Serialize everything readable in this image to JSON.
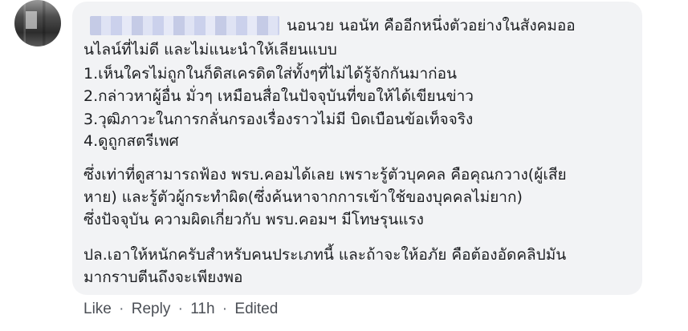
{
  "comment": {
    "first_line_text": "นอนวย นอนัท คืออีกหนึ่งตัวอย่างในสังคมออ",
    "lines": [
      "นไลน์ที่ไม่ดี และไม่แนะนำให้เลียนแบบ",
      "1.เห็นใครไม่ถูกในก็ดิสเครดิตใส่ทั้งๆที่ไม่ได้รู้จักกันมาก่อน",
      "2.กล่าวหาผู้อื่น มั่วๆ เหมือนสื่อในปัจจุบันที่ขอให้ได้เขียนข่าว",
      "3.วุฒิภาวะในการกลั่นกรองเรื่องราวไม่มี บิดเบือนข้อเท็จจริง",
      "4.ดูถูกสตรีเพศ",
      "ซึ่งเท่าที่ดูสามารถฟ้อง พรบ.คอมได้เลย เพราะรู้ตัวบุคคล คือคุณกวาง(ผู้เสีย",
      "หาย) และรู้ตัวผู้กระทำผิด(ซึ่งค้นหาจากการเข้าใช้ของบุคคลไม่ยาก)",
      "ซึ่งปัจจุบัน ความผิดเกี่ยวกับ พรบ.คอมฯ มีโทษรุนแรง",
      "ปล.เอาให้หนักครับสำหรับคนประเภทนี้ และถ้าจะให้อภัย คือต้องอัดคลิปมัน",
      "มากราบตีนถึงจะเพียงพอ"
    ]
  },
  "actions": {
    "like": "Like",
    "reply": "Reply",
    "time": "11h",
    "edited": "Edited",
    "separator": "·"
  },
  "colors": {
    "bubble_bg": "#f2f3f5",
    "text": "#1c1e21",
    "meta": "#606770"
  }
}
